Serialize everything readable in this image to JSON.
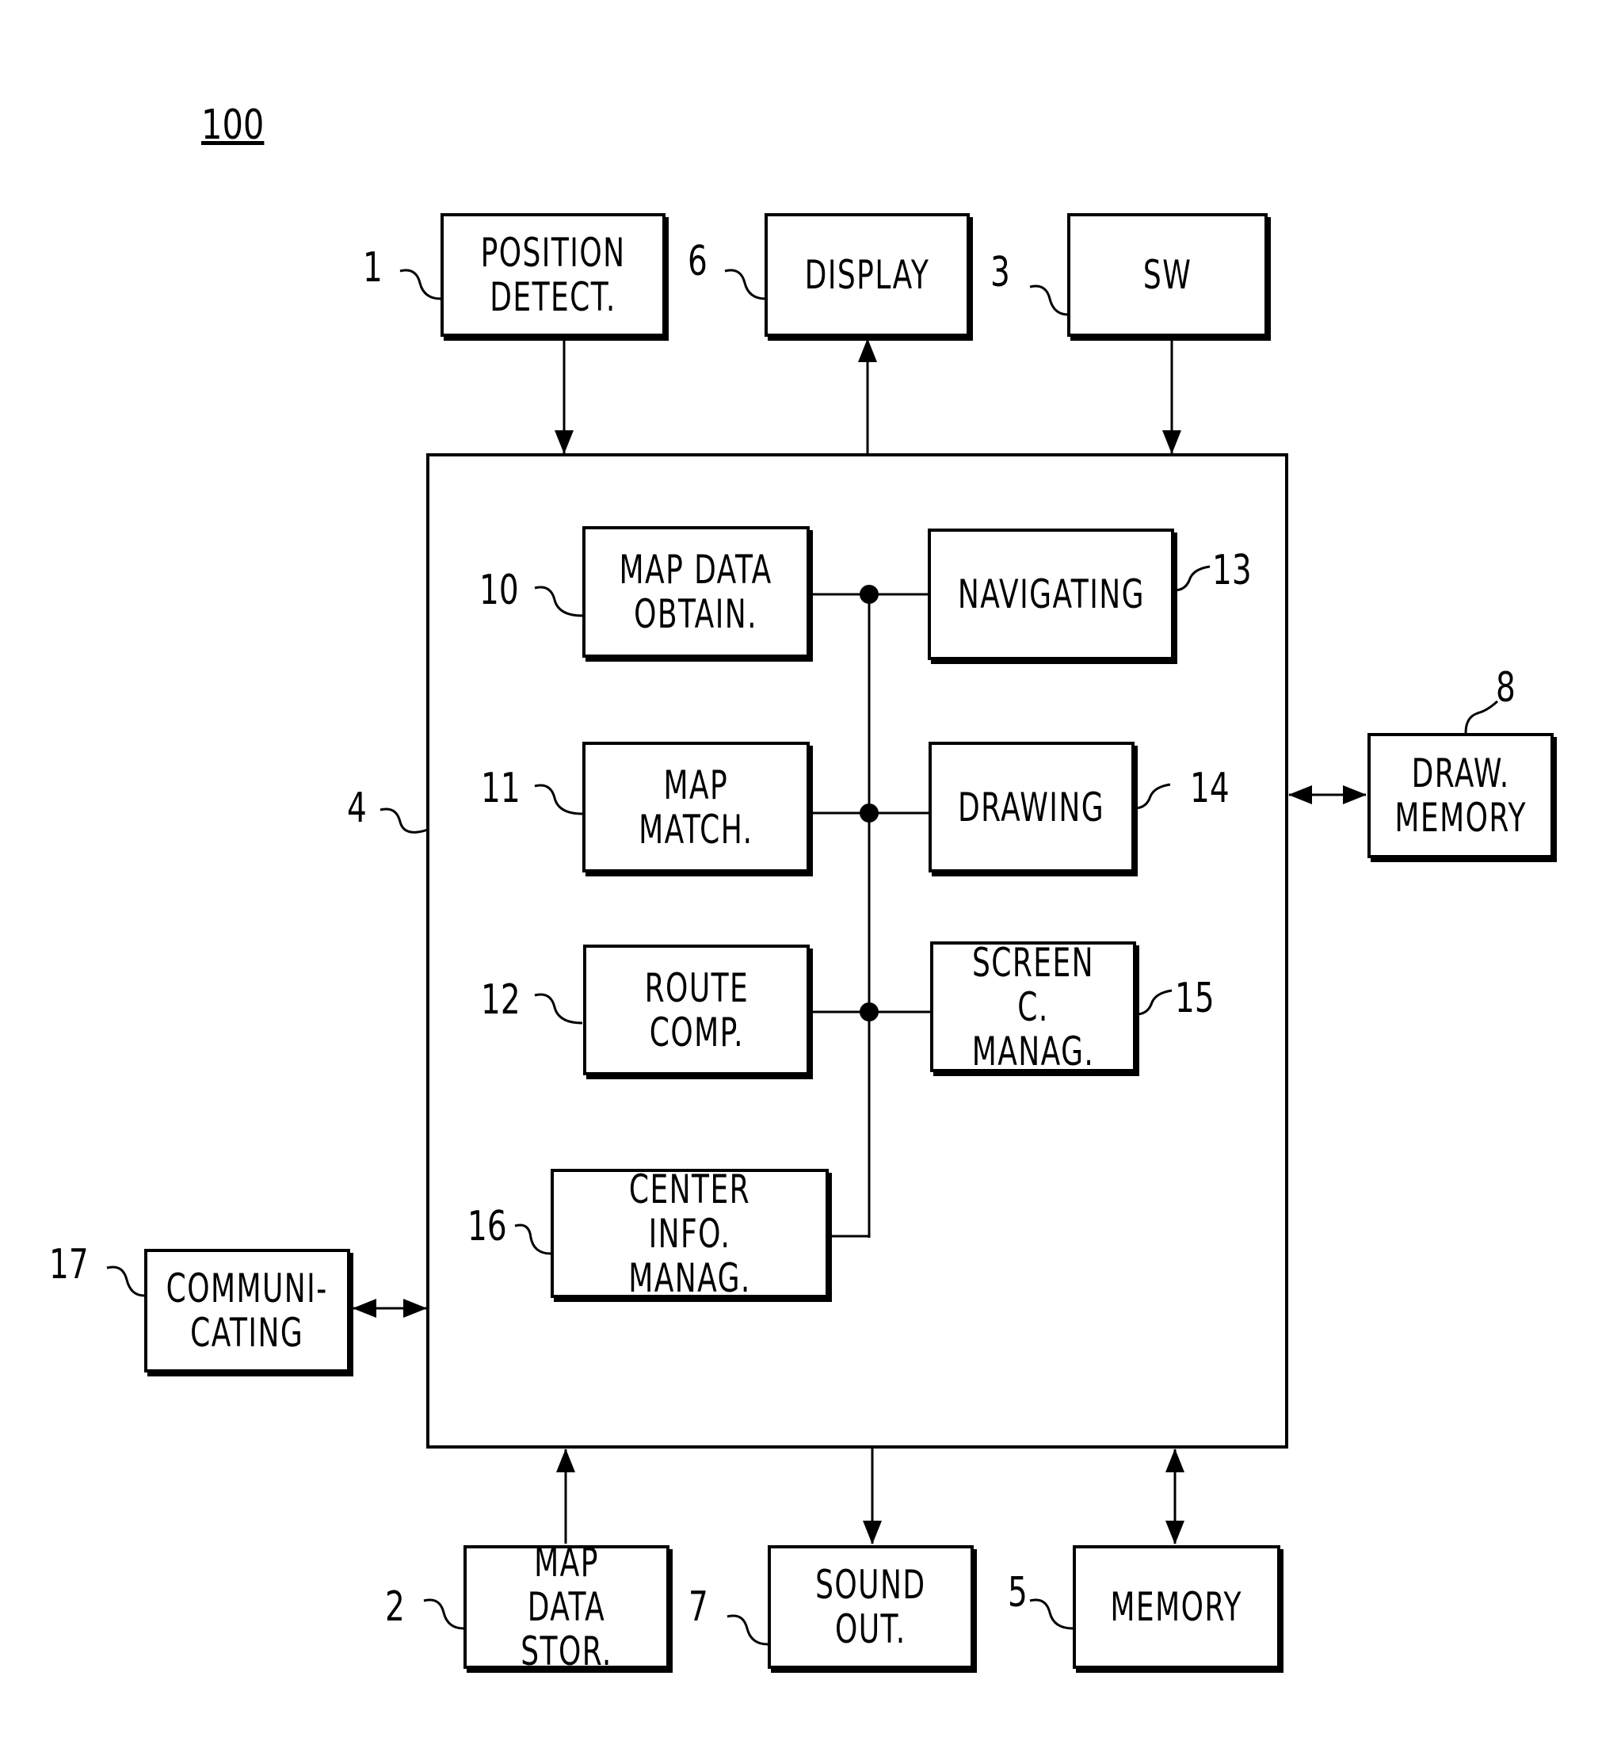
{
  "figure_label": "100",
  "blocks": {
    "position_detect": {
      "ref": "1",
      "label": "POSITION\nDETECT."
    },
    "display": {
      "ref": "6",
      "label": "DISPLAY"
    },
    "sw": {
      "ref": "3",
      "label": "SW"
    },
    "controller": {
      "ref": "4"
    },
    "map_data_obtain": {
      "ref": "10",
      "label": "MAP DATA\nOBTAIN."
    },
    "navigating": {
      "ref": "13",
      "label": "NAVIGATING"
    },
    "map_match": {
      "ref": "11",
      "label": "MAP\nMATCH."
    },
    "drawing": {
      "ref": "14",
      "label": "DRAWING"
    },
    "route_comp": {
      "ref": "12",
      "label": "ROUTE\nCOMP."
    },
    "screen_c_manag": {
      "ref": "15",
      "label": "SCREEN C.\nMANAG."
    },
    "center_info_manag": {
      "ref": "16",
      "label": "CENTER INFO.\nMANAG."
    },
    "draw_memory": {
      "ref": "8",
      "label": "DRAW.\nMEMORY"
    },
    "communicating": {
      "ref": "17",
      "label": "COMMUNI-\nCATING"
    },
    "map_data_stor": {
      "ref": "2",
      "label": "MAP DATA\nSTOR."
    },
    "sound_out": {
      "ref": "7",
      "label": "SOUND\nOUT."
    },
    "memory": {
      "ref": "5",
      "label": "MEMORY"
    }
  }
}
